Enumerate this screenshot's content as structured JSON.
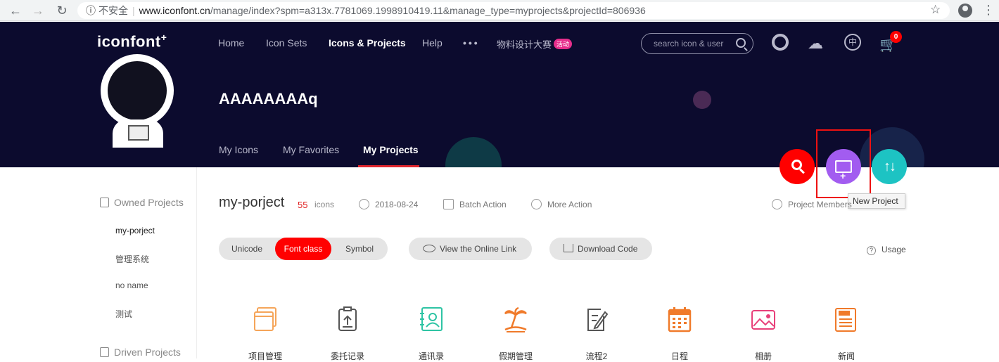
{
  "browser": {
    "back": "←",
    "forward": "→",
    "reload": "↻",
    "info": "ⓘ",
    "insecure_label": "不安全",
    "url_host": "www.iconfont.cn",
    "url_path": "/manage/index?spm=a313x.7781069.1998910419.11&manage_type=myprojects&projectId=806936",
    "star": "☆",
    "menu": "⋮"
  },
  "header": {
    "logo": "iconfont",
    "logo_mark": "+",
    "nav": [
      "Home",
      "Icon Sets",
      "Icons & Projects",
      "Help"
    ],
    "nav_more": "•••",
    "event_label": "物料设计大赛",
    "event_badge": "活动",
    "search_placeholder": "search icon & user",
    "lang_icon_label": "中",
    "cart_count": "0",
    "cloud_glyph": "☁",
    "cart_glyph": "🛒"
  },
  "profile": {
    "username": "AAAAAAAAq",
    "tabs": [
      "My Icons",
      "My Favorites",
      "My Projects"
    ],
    "active_tab": "My Projects"
  },
  "fabs": {
    "sort_glyph": "↑↓",
    "tooltip": "New Project"
  },
  "sidebar": {
    "owned_title": "Owned Projects",
    "owned_items": [
      "my-porject",
      "管理系统",
      "no name",
      "测试"
    ],
    "driven_title": "Driven Projects"
  },
  "project": {
    "name": "my-porject",
    "count": "55",
    "count_label": "icons",
    "date": "2018-08-24",
    "batch_action": "Batch Action",
    "more_action": "More Action",
    "members": "Project Members",
    "formats": [
      "Unicode",
      "Font class",
      "Symbol"
    ],
    "active_format": "Font class",
    "view_link": "View the Online Link",
    "download": "Download Code",
    "usage_q": "?",
    "usage": "Usage"
  },
  "icons": [
    {
      "label": "项目管理",
      "icon": "stack-window-icon",
      "color": "#f5a55a"
    },
    {
      "label": "委托记录",
      "icon": "clipboard-upload-icon",
      "color": "#555555"
    },
    {
      "label": "通讯录",
      "icon": "contact-book-icon",
      "color": "#2ec4a4"
    },
    {
      "label": "假期管理",
      "icon": "palm-island-icon",
      "color": "#f07a2a"
    },
    {
      "label": "流程2",
      "icon": "edit-document-icon",
      "color": "#555555"
    },
    {
      "label": "日程",
      "icon": "calendar-icon",
      "color": "#f07a2a"
    },
    {
      "label": "相册",
      "icon": "photo-album-icon",
      "color": "#e8407a"
    },
    {
      "label": "新闻",
      "icon": "news-icon",
      "color": "#f07a2a"
    }
  ],
  "colors": {
    "hero_bg": "#0c0b2e",
    "accent_red": "#ff0000",
    "purple": "#a25cf0",
    "teal": "#1dc3c3"
  }
}
